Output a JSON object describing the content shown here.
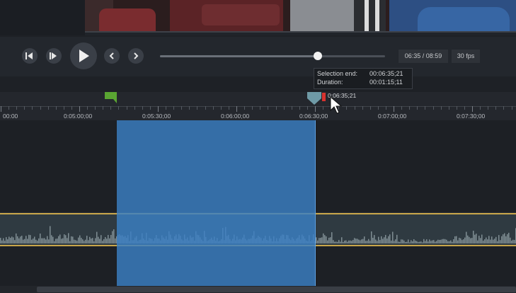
{
  "preview": {
    "description_icon": "video-frame"
  },
  "transport": {
    "time_display": "06:35 / 08:59",
    "fps_display": "30 fps",
    "scrubber_value": 0.7
  },
  "tooltip": {
    "selection_end_label": "Selection end:",
    "selection_end_value": "00:06:35;21",
    "duration_label": "Duration:",
    "duration_value": "00:01:15;11"
  },
  "ruler": {
    "playhead_time": "0:06:35;21",
    "labels": [
      "00:00",
      "0:05:00;00",
      "0:05:30;00",
      "0:06:00;00",
      "0:06:30;00",
      "0:07:00;00",
      "0:07:30;00"
    ]
  },
  "colors": {
    "selection": "#3a80c4",
    "in_marker": "#5aa532",
    "out_marker": "#6f9aa6",
    "playhead": "#d8332f",
    "audio_border": "#c9a64a"
  }
}
